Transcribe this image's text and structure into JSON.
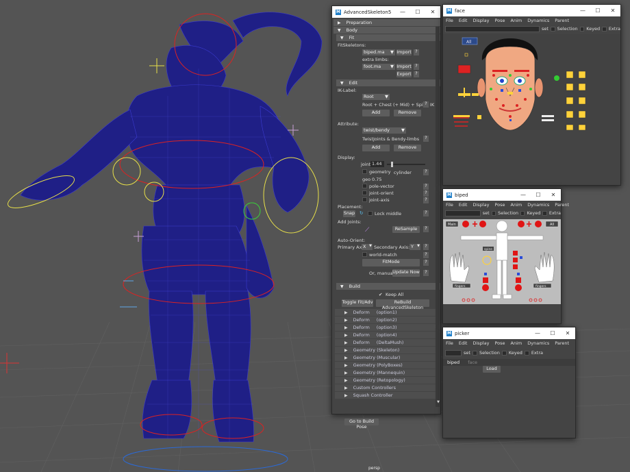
{
  "viewport": {
    "camera_label": "persp"
  },
  "advanced_skeleton": {
    "title": "AdvancedSkeleton5",
    "sections": {
      "preparation": "Preparation",
      "body": "Body",
      "fit": "Fit",
      "edit": "Edit",
      "build": "Build"
    },
    "fit": {
      "fit_skeletons_label": "FitSkeletons:",
      "skeleton_value": "biped.ma",
      "import1": "Import",
      "extra_limbs_label": "extra limbs:",
      "extra_value": "foot.ma",
      "import2": "Import",
      "export": "Export"
    },
    "edit": {
      "ik_label": "IK-Label:",
      "ik_value": "Root",
      "ik_hint": "Root + Chest (+ Mid) + Spine IK",
      "add1": "Add",
      "remove1": "Remove",
      "attribute_label": "Attribute:",
      "attribute_value": "twist/bendy",
      "attribute_hint": "TwistJoints & Bendy-limbs",
      "add2": "Add",
      "remove2": "Remove",
      "display_label": "Display:",
      "joint_label": "joint",
      "joint_value": "1.44",
      "geometry_label": "geometry",
      "geometry_dd": "cylinder",
      "geo_small": "geo",
      "geo_small_val": "0.75",
      "pole_vector": "pole-vector",
      "joint_orient": "joint-orient",
      "joint_axis": "joint-axis",
      "placement_label": "Placement:",
      "snap": "Snap",
      "lock_middle": "Lock middle",
      "add_joints_label": "Add Joints:",
      "resample": "ReSample",
      "auto_orient_label": "Auto-Orient:",
      "primary_axis": "Primary Axis:",
      "primary_value": "X",
      "secondary_axis": "Secondary Axis:",
      "secondary_value": "Y",
      "world_match": "world-match",
      "fitmode": "FitMode",
      "or_manual": "Or, manual:",
      "update_now": "Update Now"
    },
    "build": {
      "keep_all": "Keep All",
      "toggle_fit": "Toggle Fit/Adv",
      "rebuild": "ReBuild AdvancedSkeleton",
      "items": [
        {
          "name": "Deform",
          "opt": "(option1)"
        },
        {
          "name": "Deform",
          "opt": "(option2)"
        },
        {
          "name": "Deform",
          "opt": "(option3)"
        },
        {
          "name": "Deform",
          "opt": "(option4)"
        },
        {
          "name": "Deform",
          "opt": "(DeltaMush)"
        },
        {
          "name": "Geometry (Skeleton)",
          "opt": ""
        },
        {
          "name": "Geometry (Muscular)",
          "opt": ""
        },
        {
          "name": "Geometry (PolyBoxes)",
          "opt": ""
        },
        {
          "name": "Geometry (Mannequin)",
          "opt": ""
        },
        {
          "name": "Geometry (Retopology)",
          "opt": ""
        },
        {
          "name": "Custom Controllers",
          "opt": ""
        },
        {
          "name": "Squash Controller",
          "opt": ""
        }
      ],
      "go_to_build_pose": "Go to Build Pose"
    },
    "question": "?"
  },
  "face_win": {
    "title": "face",
    "menu": [
      "File",
      "Edit",
      "Display",
      "Pose",
      "Anim",
      "Dynamics",
      "Parent"
    ],
    "set": "set",
    "selection": "Selection",
    "keyed": "Keyed",
    "extra": "Extra",
    "all": "All"
  },
  "biped_win": {
    "title": "biped",
    "menu": [
      "File",
      "Edit",
      "Display",
      "Pose",
      "Anim",
      "Dynamics",
      "Parent"
    ],
    "set": "set",
    "selection": "Selection",
    "keyed": "Keyed",
    "extra": "Extra",
    "main": "Main",
    "all": "All",
    "spine": "spine",
    "fingers_l": "fingers",
    "fingers_r": "fingers"
  },
  "picker_win": {
    "title": "picker",
    "menu": [
      "File",
      "Edit",
      "Display",
      "Pose",
      "Anim",
      "Dynamics",
      "Parent"
    ],
    "set": "set",
    "selection": "Selection",
    "keyed": "Keyed",
    "extra": "Extra",
    "tab_biped": "biped",
    "tab_face": "face",
    "load": "Load"
  },
  "colors": {
    "viewport_bg": "#545454",
    "mesh": "#1c1c8c",
    "picker_red": "#e01515",
    "picker_yellow": "#f0d21c"
  }
}
